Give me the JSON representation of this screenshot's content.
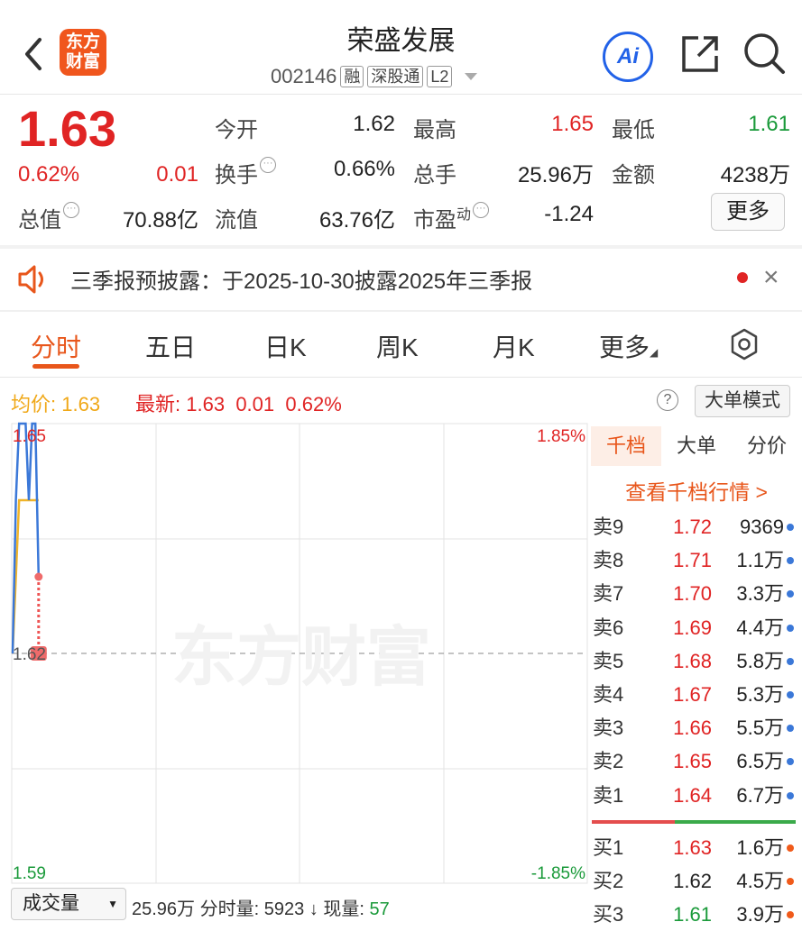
{
  "header": {
    "title": "荣盛发展",
    "code": "002146",
    "tags": [
      "融",
      "深股通",
      "L2"
    ],
    "logo_text": [
      "东方",
      "财富"
    ],
    "ai_label": "Ai"
  },
  "quote": {
    "price": "1.63",
    "change_pct": "0.62%",
    "change": "0.01",
    "fields": [
      {
        "label": "今开",
        "value": "1.62"
      },
      {
        "label": "最高",
        "value": "1.65"
      },
      {
        "label": "最低",
        "value": "1.61"
      },
      {
        "label": "换手",
        "value": "0.66%"
      },
      {
        "label": "总手",
        "value": "25.96万"
      },
      {
        "label": "金额",
        "value": "4238万"
      },
      {
        "label": "总值",
        "value": "70.88亿"
      },
      {
        "label": "流值",
        "value": "63.76亿"
      },
      {
        "label": "市盈",
        "sup": "动",
        "value": "-1.24"
      }
    ],
    "more_button": "更多"
  },
  "notice": {
    "text": "三季报预披露：于2025-10-30披露2025年三季报",
    "close": "×"
  },
  "tabs": [
    "分时",
    "五日",
    "日K",
    "周K",
    "月K",
    "更多"
  ],
  "info_line": {
    "avg_label": "均价:",
    "avg_value": "1.63",
    "latest_label": "最新:",
    "latest_value": "1.63",
    "latest_change": "0.01",
    "latest_pct": "0.62%",
    "help": "?",
    "mode_button": "大单模式"
  },
  "chart_labels": {
    "top_left": "1.65",
    "top_right": "1.85%",
    "mid_left": "1.62",
    "bottom_left": "1.59",
    "bottom_right": "-1.85%",
    "watermark": "东方财富"
  },
  "chart_data": {
    "type": "line",
    "ylim": [
      1.59,
      1.65
    ],
    "reference": 1.62,
    "series": [
      {
        "name": "price",
        "color": "#3b78d8",
        "values": [
          1.62,
          1.64,
          1.65,
          1.65,
          1.65,
          1.64,
          1.65,
          1.65,
          1.63
        ]
      },
      {
        "name": "avg",
        "color": "#f0b429",
        "values": [
          1.62,
          1.63,
          1.64,
          1.64,
          1.64,
          1.64,
          1.64,
          1.64,
          1.64
        ]
      }
    ]
  },
  "order_book": {
    "tabs": [
      "千档",
      "大单",
      "分价"
    ],
    "link": "查看千档行情 >",
    "sell": [
      {
        "label": "卖9",
        "price": "1.72",
        "vol": "9369",
        "dot": "#3b78d8"
      },
      {
        "label": "卖8",
        "price": "1.71",
        "vol": "1.1万",
        "dot": "#3b78d8"
      },
      {
        "label": "卖7",
        "price": "1.70",
        "vol": "3.3万",
        "dot": "#3b78d8"
      },
      {
        "label": "卖6",
        "price": "1.69",
        "vol": "4.4万",
        "dot": "#3b78d8"
      },
      {
        "label": "卖5",
        "price": "1.68",
        "vol": "5.8万",
        "dot": "#3b78d8"
      },
      {
        "label": "卖4",
        "price": "1.67",
        "vol": "5.3万",
        "dot": "#3b78d8"
      },
      {
        "label": "卖3",
        "price": "1.66",
        "vol": "5.5万",
        "dot": "#3b78d8"
      },
      {
        "label": "卖2",
        "price": "1.65",
        "vol": "6.5万",
        "dot": "#3b78d8"
      },
      {
        "label": "卖1",
        "price": "1.64",
        "vol": "6.7万",
        "dot": "#3b78d8"
      }
    ],
    "buy": [
      {
        "label": "买1",
        "price": "1.63",
        "vol": "1.6万",
        "dot": "#f05a1a",
        "color": "#e02424"
      },
      {
        "label": "买2",
        "price": "1.62",
        "vol": "4.5万",
        "dot": "#f05a1a",
        "color": "#222222"
      },
      {
        "label": "买3",
        "price": "1.61",
        "vol": "3.9万",
        "dot": "#f05a1a",
        "color": "#1a9a3a"
      }
    ]
  },
  "bottom_bar": {
    "selector": "成交量",
    "volume": "25.96万",
    "tick_label": "分时量:",
    "tick_value": "5923",
    "arrow": "↓",
    "now_label": "现量:",
    "now_value": "57"
  }
}
